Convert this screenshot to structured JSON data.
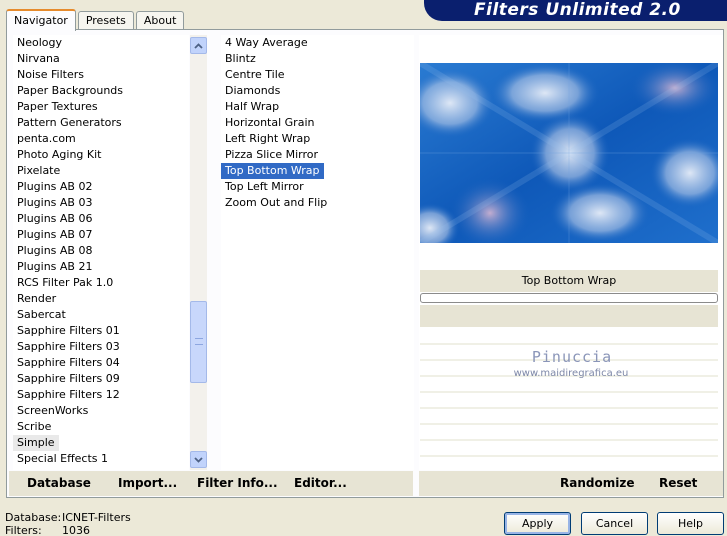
{
  "app": {
    "title": "Filters Unlimited 2.0"
  },
  "tabs": [
    {
      "label": "Navigator",
      "active": true
    },
    {
      "label": "Presets",
      "active": false
    },
    {
      "label": "About",
      "active": false
    }
  ],
  "categories": {
    "items": [
      "Neology",
      "Nirvana",
      "Noise Filters",
      "Paper Backgrounds",
      "Paper Textures",
      "Pattern Generators",
      "penta.com",
      "Photo Aging Kit",
      "Pixelate",
      "Plugins AB 02",
      "Plugins AB 03",
      "Plugins AB 06",
      "Plugins AB 07",
      "Plugins AB 08",
      "Plugins AB 21",
      "RCS Filter Pak 1.0",
      "Render",
      "Sabercat",
      "Sapphire Filters 01",
      "Sapphire Filters 03",
      "Sapphire Filters 04",
      "Sapphire Filters 09",
      "Sapphire Filters 12",
      "ScreenWorks",
      "Scribe",
      "Simple",
      "Special Effects 1"
    ],
    "selected": "Simple"
  },
  "filters": {
    "items": [
      "4 Way Average",
      "Blintz",
      "Centre Tile",
      "Diamonds",
      "Half Wrap",
      "Horizontal Grain",
      "Left Right Wrap",
      "Pizza Slice Mirror",
      "Top Bottom Wrap",
      "Top Left Mirror",
      "Zoom Out and Flip"
    ],
    "selected": "Top Bottom Wrap"
  },
  "preview": {
    "filter_name": "Top Bottom Wrap",
    "watermark_name": "Pinuccia",
    "watermark_url": "www.maidiregrafica.eu",
    "colors": {
      "base": "#1a64c0",
      "light": "#c3d6ee",
      "pink": "#c8a6c8"
    }
  },
  "toolbar": {
    "database": "Database",
    "import": "Import...",
    "filter_info": "Filter Info...",
    "editor": "Editor...",
    "randomize": "Randomize",
    "reset": "Reset"
  },
  "status": {
    "database_label": "Database:",
    "database_value": "ICNET-Filters",
    "filters_label": "Filters:",
    "filters_value": "1036"
  },
  "buttons": {
    "apply": "Apply",
    "cancel": "Cancel",
    "help": "Help"
  },
  "colors": {
    "banner": "#0a1f6e",
    "selection": "#316ac5",
    "tab_accent": "#e68b2c"
  }
}
